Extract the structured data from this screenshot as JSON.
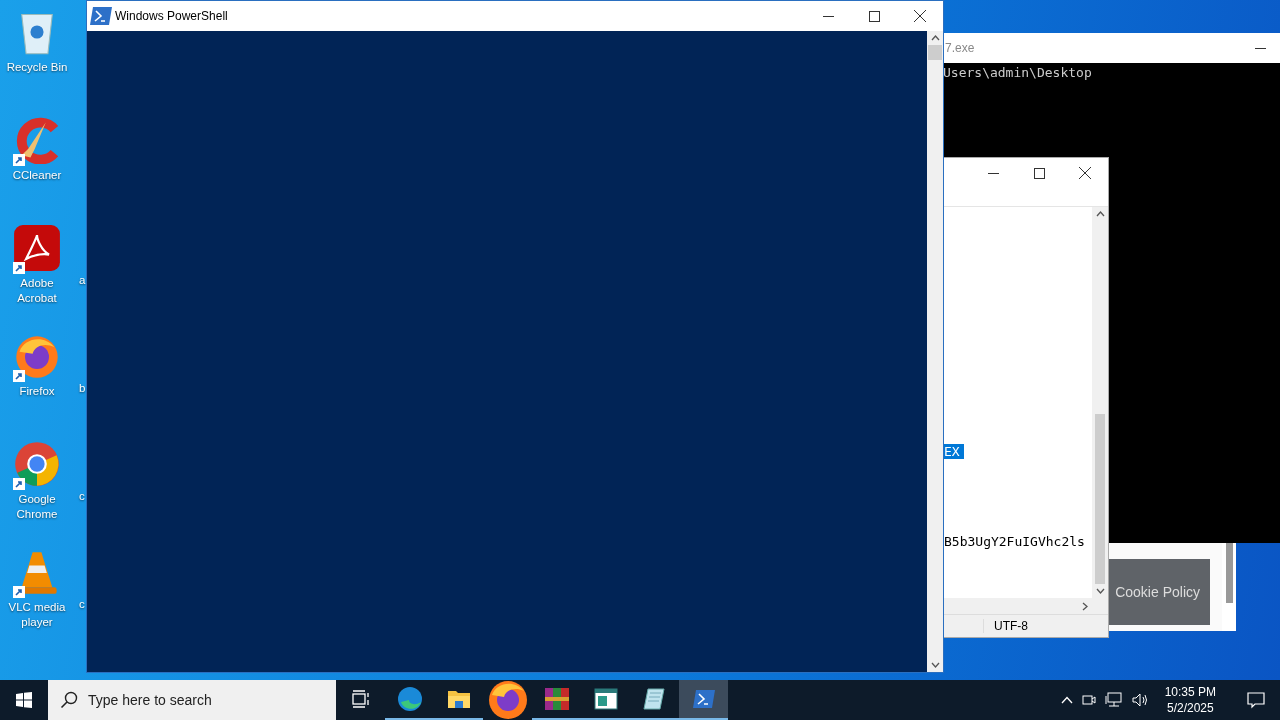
{
  "desktop_icons": [
    {
      "label": "Recycle Bin",
      "kind": "recycle",
      "shortcut": false
    },
    {
      "label": "CCleaner",
      "kind": "ccleaner",
      "shortcut": true
    },
    {
      "label": "Adobe Acrobat",
      "kind": "acrobat",
      "shortcut": true
    },
    {
      "label": "Firefox",
      "kind": "firefox",
      "shortcut": true
    },
    {
      "label": "Google Chrome",
      "kind": "chrome",
      "shortcut": true
    },
    {
      "label": "VLC media player",
      "kind": "vlc",
      "shortcut": true
    }
  ],
  "cut_labels": [
    "a",
    "b",
    "c",
    "c"
  ],
  "console_window": {
    "title": "7.exe",
    "lines": [
      "Users\\admin\\Desktop"
    ]
  },
  "editor_window": {
    "lines": [
      {
        "text": "EX",
        "selected": true
      },
      {
        "text": "B5b3UgY2FuIGVhc2ls",
        "selected": false
      }
    ],
    "encoding": "UTF-8"
  },
  "browser_window": {
    "banner": "Cookie Policy"
  },
  "powershell_window": {
    "title": "Windows PowerShell"
  },
  "taskbar": {
    "search": {
      "placeholder": "Type here to search"
    },
    "apps": [
      {
        "kind": "edge",
        "running": true,
        "selected": false
      },
      {
        "kind": "explorer",
        "running": true,
        "selected": false
      },
      {
        "kind": "firefox",
        "running": false,
        "selected": false
      },
      {
        "kind": "winrar",
        "running": true,
        "selected": false
      },
      {
        "kind": "sheet",
        "running": true,
        "selected": false
      },
      {
        "kind": "notepad",
        "running": true,
        "selected": false
      },
      {
        "kind": "powershell",
        "running": true,
        "selected": true
      }
    ],
    "time": "10:35 PM",
    "date": "5/2/2025"
  }
}
